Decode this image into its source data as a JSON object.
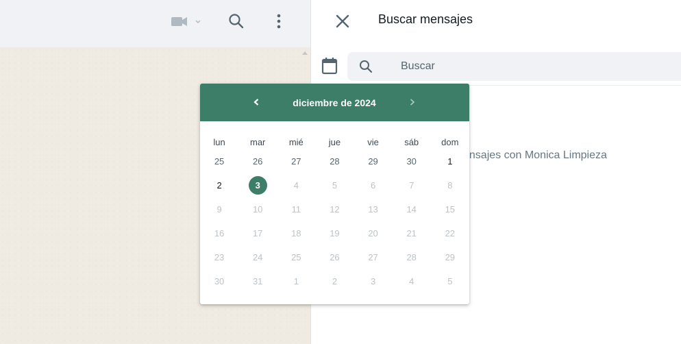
{
  "chat_header": {
    "icons": [
      "video-call-icon",
      "chevron-down-icon",
      "search-icon",
      "menu-dots-icon"
    ]
  },
  "search_panel": {
    "title": "Buscar mensajes",
    "search_placeholder": "Buscar",
    "info_text": "ensajes con Monica Limpieza",
    "icons": [
      "close-icon",
      "calendar-icon",
      "search-icon"
    ]
  },
  "calendar": {
    "month_label": "diciembre de 2024",
    "weekdays": [
      "lun",
      "mar",
      "mié",
      "jue",
      "vie",
      "sáb",
      "dom"
    ],
    "weeks": [
      [
        "25",
        "26",
        "27",
        "28",
        "29",
        "30",
        "1"
      ],
      [
        "2",
        "3",
        "4",
        "5",
        "6",
        "7",
        "8"
      ],
      [
        "9",
        "10",
        "11",
        "12",
        "13",
        "14",
        "15"
      ],
      [
        "16",
        "17",
        "18",
        "19",
        "20",
        "21",
        "22"
      ],
      [
        "23",
        "24",
        "25",
        "26",
        "27",
        "28",
        "29"
      ],
      [
        "30",
        "31",
        "1",
        "2",
        "3",
        "4",
        "5"
      ]
    ],
    "selected_day": "3",
    "accent_color": "#3d7e69"
  }
}
